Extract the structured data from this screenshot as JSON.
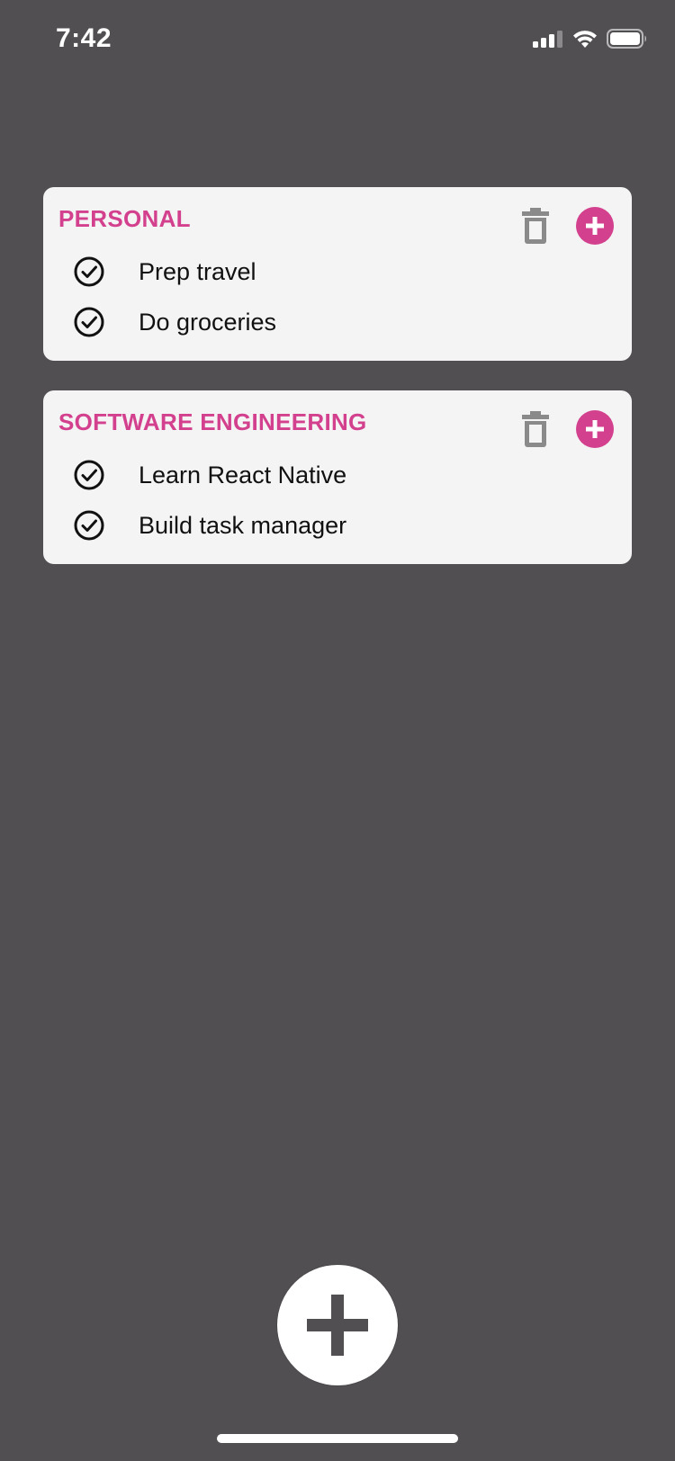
{
  "status_bar": {
    "time": "7:42",
    "icons": [
      "cellular-signal-icon",
      "wifi-icon",
      "battery-icon"
    ]
  },
  "categories": [
    {
      "title": "PERSONAL",
      "tasks": [
        {
          "label": "Prep travel"
        },
        {
          "label": "Do groceries"
        }
      ]
    },
    {
      "title": "SOFTWARE ENGINEERING",
      "tasks": [
        {
          "label": "Learn React Native"
        },
        {
          "label": "Build task manager"
        }
      ]
    }
  ],
  "colors": {
    "background": "#524f53",
    "card": "#f4f4f4",
    "accent": "#d3418e",
    "trash_icon": "#8a8a8a",
    "fab": "#ffffff",
    "fab_icon": "#524f53"
  }
}
